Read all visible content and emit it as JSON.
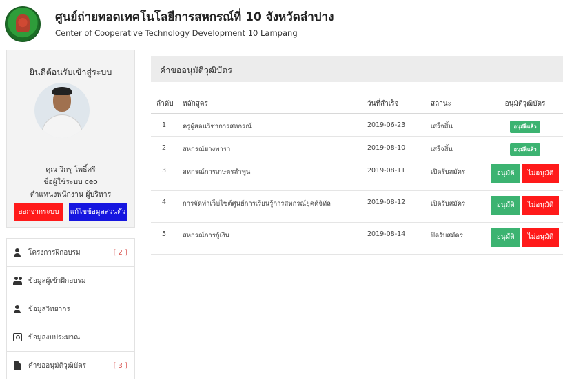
{
  "header": {
    "title_th": "ศูนย์ถ่ายทอดเทคโนโลยีการสหกรณ์ที่ 10 จังหวัดลำปาง",
    "title_en": "Center of Cooperative Technology Development 10 Lampang"
  },
  "profile": {
    "welcome": "ยินดีต้อนรับเข้าสู่ระบบ",
    "name": "คุณ วิกรุ โพธิ์ศรี",
    "username": "ชื่อผู้ใช้ระบบ ceo",
    "position": "ตำแหน่งพนักงาน ผู้บริหาร",
    "logout_label": "ออกจากระบบ",
    "edit_label": "แก้ไขข้อมูลส่วนตัว"
  },
  "menu": {
    "items": [
      {
        "label": "โครงการฝึกอบรม",
        "count": "[ 2 ]",
        "icon": "user-icon"
      },
      {
        "label": "ข้อมูลผู้เข้าฝึกอบรม",
        "count": "",
        "icon": "users-icon"
      },
      {
        "label": "ข้อมูลวิทยากร",
        "count": "",
        "icon": "user-icon"
      },
      {
        "label": "ข้อมูลงบประมาณ",
        "count": "",
        "icon": "money-icon"
      },
      {
        "label": "คำขออนุมัติวุฒิบัตร",
        "count": "[ 3 ]",
        "icon": "file-icon"
      }
    ]
  },
  "main": {
    "page_title": "คำขออนุมัติวุฒิบัตร",
    "columns": [
      "ลำดับ",
      "หลักสูตร",
      "วันที่สำเร็จ",
      "สถานะ",
      "อนุมัติวุฒิบัตร"
    ],
    "approved_badge": "อนุมัติแล้ว",
    "approve_label": "อนุมัติ",
    "reject_label": "ไม่อนุมัติ",
    "rows": [
      {
        "no": "1",
        "course": "ครูผู้สอนวิชาการสหกรณ์",
        "date": "2019-06-23",
        "status": "เสร็จสิ้น",
        "state": "approved"
      },
      {
        "no": "2",
        "course": "สหกรณ์ยางพารา",
        "date": "2019-08-10",
        "status": "เสร็จสิ้น",
        "state": "approved"
      },
      {
        "no": "3",
        "course": "สหกรณ์การเกษตรลำพูน",
        "date": "2019-08-11",
        "status": "เปิดรับสมัคร",
        "state": "pending"
      },
      {
        "no": "4",
        "course": "การจัดทำเว็บไซต์ศูนย์การเรียนรู้การสหกรณ์ยุคดิจิทัล",
        "date": "2019-08-12",
        "status": "เปิดรับสมัคร",
        "state": "pending"
      },
      {
        "no": "5",
        "course": "สหกรณ์การกู้เงิน",
        "date": "2019-08-14",
        "status": "ปิดรับสมัคร",
        "state": "pending"
      }
    ]
  },
  "colors": {
    "approve": "#3cb371",
    "reject": "#ff1a1a",
    "edit": "#1616e0",
    "count": "#d9534f"
  }
}
